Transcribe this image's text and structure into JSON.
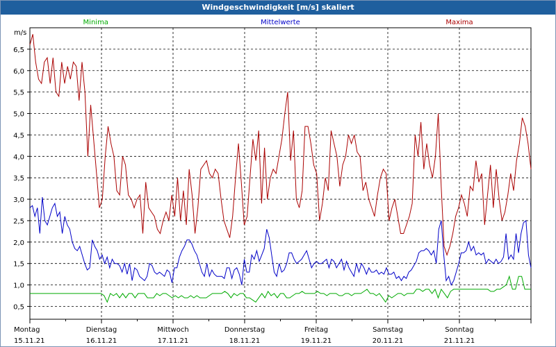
{
  "window": {
    "title": "Windgeschwindigkeit [m/s] skaliert"
  },
  "chart_data": {
    "type": "line",
    "title": "Windgeschwindigkeit [m/s] skaliert",
    "ylabel": "m/s",
    "xlabel": "",
    "ylim": [
      0.2,
      7.0
    ],
    "xlim": [
      0,
      7
    ],
    "y_ticks": [
      "0,5",
      "1,0",
      "1,5",
      "2,0",
      "2,5",
      "3,0",
      "3,5",
      "4,0",
      "4,5",
      "5,0",
      "5,5",
      "6,0",
      "6,5"
    ],
    "y_tick_values": [
      0.5,
      1.0,
      1.5,
      2.0,
      2.5,
      3.0,
      3.5,
      4.0,
      4.5,
      5.0,
      5.5,
      6.0,
      6.5
    ],
    "x_days": [
      "Montag",
      "Dienstag",
      "Mittwoch",
      "Donnerstag",
      "Freitag",
      "Samstag",
      "Sonntag"
    ],
    "x_dates": [
      "15.11.21",
      "16.11.21",
      "17.11.21",
      "18.11.21",
      "19.11.21",
      "20.11.21",
      "21.11.21"
    ],
    "grid": true,
    "legend": "top",
    "series": [
      {
        "name": "Minima",
        "color": "#00aa00",
        "values": [
          0.8,
          0.8,
          0.8,
          0.8,
          0.8,
          0.8,
          0.8,
          0.8,
          0.8,
          0.8,
          0.8,
          0.8,
          0.8,
          0.8,
          0.8,
          0.8,
          0.8,
          0.8,
          0.8,
          0.8,
          0.8,
          0.8,
          0.8,
          0.8,
          0.75,
          0.6,
          0.8,
          0.75,
          0.8,
          0.7,
          0.8,
          0.7,
          0.8,
          0.8,
          0.7,
          0.8,
          0.8,
          0.8,
          0.7,
          0.7,
          0.7,
          0.8,
          0.75,
          0.8,
          0.8,
          0.75,
          0.7,
          0.75,
          0.7,
          0.75,
          0.7,
          0.7,
          0.75,
          0.7,
          0.75,
          0.7,
          0.7,
          0.7,
          0.75,
          0.8,
          0.8,
          0.8,
          0.8,
          0.85,
          0.8,
          0.7,
          0.8,
          0.75,
          0.8,
          0.8,
          0.7,
          0.7,
          0.65,
          0.6,
          0.7,
          0.8,
          0.7,
          0.85,
          0.75,
          0.8,
          0.7,
          0.8,
          0.8,
          0.7,
          0.7,
          0.75,
          0.8,
          0.8,
          0.85,
          0.8,
          0.8,
          0.8,
          0.8,
          0.85,
          0.8,
          0.8,
          0.75,
          0.8,
          0.8,
          0.8,
          0.75,
          0.75,
          0.8,
          0.8,
          0.75,
          0.8,
          0.8,
          0.8,
          0.85,
          0.9,
          0.8,
          0.8,
          0.75,
          0.8,
          0.7,
          0.6,
          0.75,
          0.7,
          0.75,
          0.8,
          0.8,
          0.75,
          0.8,
          0.8,
          0.8,
          0.9,
          0.9,
          0.85,
          0.9,
          0.9,
          0.8,
          0.9,
          0.7,
          0.9,
          0.8,
          0.7,
          0.85,
          0.9,
          0.9,
          0.9,
          0.9,
          0.9,
          0.9,
          0.9,
          0.9,
          0.9,
          0.9,
          0.9,
          0.9,
          0.85,
          0.85,
          0.9,
          0.9,
          0.95,
          1.0,
          1.2,
          0.9,
          0.9,
          1.2,
          1.2,
          0.9,
          0.9,
          0.9
        ]
      },
      {
        "name": "Mittelwerte",
        "color": "#0000c8",
        "values": [
          2.8,
          2.85,
          2.6,
          2.8,
          2.2,
          3.05,
          2.5,
          2.4,
          2.6,
          2.8,
          2.9,
          2.6,
          2.7,
          2.2,
          2.6,
          2.4,
          2.3,
          2.0,
          1.85,
          1.8,
          1.9,
          1.7,
          1.5,
          1.35,
          1.4,
          2.05,
          1.9,
          1.8,
          1.6,
          1.7,
          1.5,
          1.65,
          1.4,
          1.6,
          1.5,
          1.5,
          1.45,
          1.3,
          1.5,
          1.25,
          1.5,
          1.1,
          1.4,
          1.35,
          1.2,
          1.15,
          1.1,
          1.2,
          1.5,
          1.45,
          1.3,
          1.25,
          1.3,
          1.25,
          1.2,
          1.35,
          1.3,
          1.05,
          1.4,
          1.4,
          1.65,
          1.8,
          1.9,
          2.05,
          2.05,
          1.95,
          1.8,
          1.7,
          1.5,
          1.3,
          1.2,
          1.5,
          1.2,
          1.35,
          1.25,
          1.2,
          1.2,
          1.2,
          1.15,
          1.4,
          1.4,
          1.15,
          1.35,
          1.4,
          1.25,
          1.0,
          1.6,
          1.3,
          1.3,
          1.7,
          1.6,
          1.8,
          1.55,
          1.7,
          1.85,
          2.3,
          2.1,
          1.7,
          1.3,
          1.2,
          1.5,
          1.3,
          1.35,
          1.5,
          1.75,
          1.75,
          1.6,
          1.5,
          1.55,
          1.6,
          1.7,
          1.8,
          1.6,
          1.4,
          1.5,
          1.55,
          1.5,
          1.5,
          1.55,
          1.6,
          1.4,
          1.6,
          1.55,
          1.4,
          1.5,
          1.6,
          1.35,
          1.55,
          1.4,
          1.3,
          1.2,
          1.5,
          1.3,
          1.5,
          1.4,
          1.25,
          1.4,
          1.3,
          1.3,
          1.35,
          1.25,
          1.3,
          1.25,
          1.4,
          1.25,
          1.25,
          1.3,
          1.15,
          1.2,
          1.1,
          1.2,
          1.15,
          1.3,
          1.35,
          1.45,
          1.55,
          1.75,
          1.8,
          1.8,
          1.85,
          1.8,
          1.7,
          1.8,
          1.5,
          2.3,
          2.5,
          1.7,
          1.1,
          1.2,
          1.0,
          1.1,
          1.3,
          1.5,
          1.75,
          1.75,
          1.8,
          2.0,
          1.8,
          1.9,
          1.7,
          1.75,
          1.7,
          1.75,
          1.5,
          1.6,
          1.55,
          1.5,
          1.6,
          1.5,
          1.55,
          1.65,
          2.2,
          1.6,
          1.7,
          1.6,
          2.2,
          1.75,
          2.2,
          2.45,
          2.5,
          1.7,
          1.4
        ]
      },
      {
        "name": "Maxima",
        "color": "#aa0000",
        "values": [
          6.6,
          6.85,
          6.2,
          5.8,
          5.7,
          6.2,
          6.3,
          5.7,
          6.3,
          5.5,
          5.4,
          6.2,
          5.7,
          6.1,
          5.8,
          6.2,
          6.1,
          5.3,
          6.2,
          5.5,
          4.0,
          5.2,
          4.4,
          3.6,
          2.8,
          3.0,
          4.0,
          4.7,
          4.3,
          4.0,
          3.2,
          3.1,
          4.0,
          3.8,
          3.1,
          3.0,
          2.8,
          3.0,
          3.1,
          2.2,
          3.4,
          2.8,
          2.7,
          2.6,
          2.3,
          2.2,
          2.5,
          2.7,
          2.5,
          3.1,
          2.6,
          3.5,
          2.5,
          3.2,
          2.4,
          3.7,
          3.1,
          2.2,
          2.8,
          3.7,
          3.8,
          3.9,
          3.6,
          3.5,
          3.7,
          3.6,
          3.0,
          2.5,
          2.3,
          2.1,
          2.6,
          3.5,
          4.3,
          3.4,
          2.4,
          2.6,
          3.5,
          4.4,
          3.9,
          4.6,
          2.9,
          4.2,
          3.0,
          3.5,
          3.7,
          3.6,
          4.0,
          4.4,
          5.0,
          5.5,
          3.9,
          4.6,
          3.0,
          2.8,
          3.2,
          4.7,
          4.7,
          4.3,
          3.8,
          3.6,
          2.5,
          2.9,
          3.5,
          3.2,
          4.6,
          4.3,
          4.0,
          3.3,
          3.8,
          4.0,
          4.5,
          4.3,
          4.5,
          4.1,
          4.0,
          3.2,
          3.4,
          3.0,
          2.8,
          2.6,
          3.1,
          3.5,
          3.7,
          3.6,
          2.5,
          2.8,
          3.0,
          2.6,
          2.2,
          2.2,
          2.4,
          2.6,
          2.9,
          4.5,
          4.0,
          4.8,
          3.7,
          4.3,
          3.8,
          3.5,
          4.0,
          5.0,
          3.3,
          1.9,
          1.7,
          1.9,
          2.2,
          2.6,
          2.8,
          3.1,
          2.9,
          2.6,
          3.3,
          3.2,
          3.9,
          3.4,
          3.6,
          2.4,
          3.1,
          3.8,
          2.8,
          3.7,
          3.0,
          2.5,
          2.7,
          3.1,
          3.6,
          3.2,
          3.9,
          4.3,
          4.9,
          4.7,
          4.3,
          3.7
        ]
      }
    ]
  }
}
